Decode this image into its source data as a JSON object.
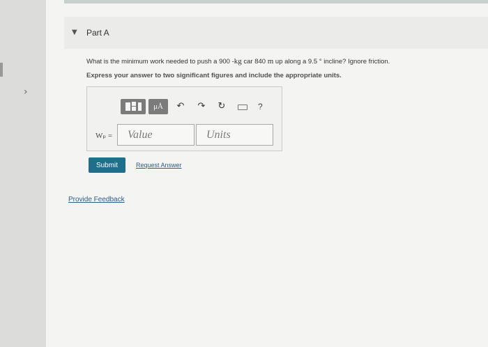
{
  "part": {
    "title": "Part A"
  },
  "question": {
    "text_before": "What is the minimum work needed to push a 900 -",
    "mass_unit": "kg",
    "text_middle": " car 840 ",
    "distance_unit": "m",
    "text_after": " up along a 9.5 ° incline? Ignore friction.",
    "instruction": "Express your answer to two significant figures and include the appropriate units."
  },
  "toolbar": {
    "mu_label": "μÅ",
    "undo_icon": "undo-icon",
    "redo_icon": "redo-icon",
    "reset_icon": "reset-icon",
    "keyboard_icon": "keyboard-icon",
    "help_label": "?"
  },
  "answer": {
    "variable_label": "Wₚ =",
    "value_placeholder": "Value",
    "units_placeholder": "Units"
  },
  "actions": {
    "submit_label": "Submit",
    "request_answer_label": "Request Answer",
    "feedback_label": "Provide Feedback"
  },
  "colors": {
    "submit_bg": "#1f6e8c",
    "link": "#2a5d8c",
    "toolbar_button": "#7b7b7b"
  }
}
